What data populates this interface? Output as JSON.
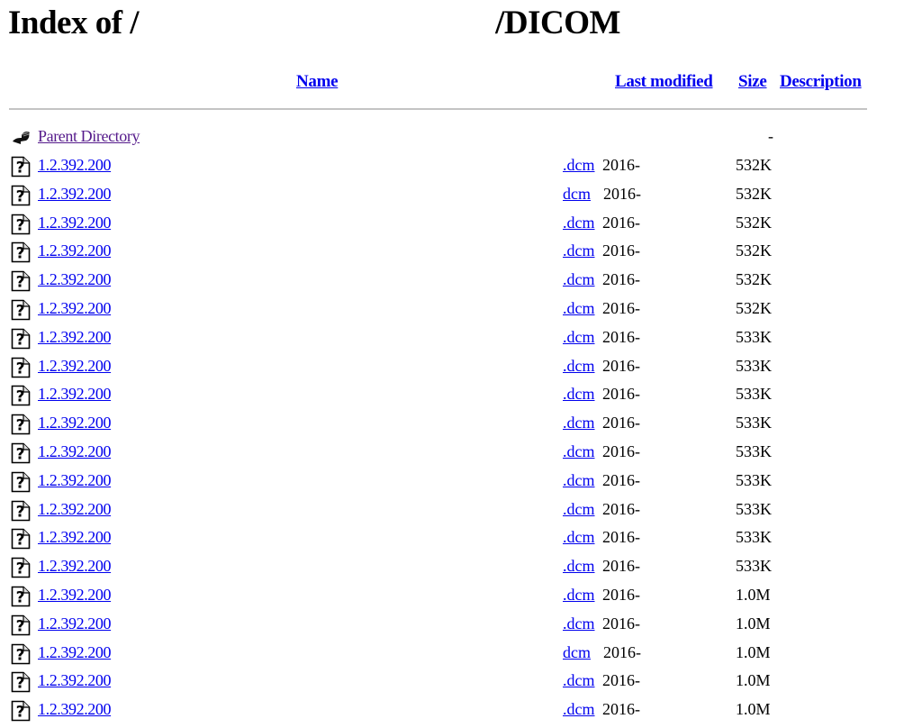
{
  "title": {
    "prefix": "Index of /",
    "suffix": "/DICOM"
  },
  "columns": {
    "name": "Name",
    "last_modified": "Last modified",
    "size": "Size",
    "description": "Description"
  },
  "parent": {
    "label": "Parent Directory",
    "size": "-",
    "icon": "back-arrow-icon"
  },
  "files": [
    {
      "name": "1.2.392.200",
      "ext": ".dcm",
      "date": "2016-",
      "size": "532K",
      "icon": "unknown-file-icon"
    },
    {
      "name": "1.2.392.200",
      "ext": "dcm",
      "date": "2016-",
      "size": "532K",
      "icon": "unknown-file-icon"
    },
    {
      "name": "1.2.392.200",
      "ext": ".dcm",
      "date": "2016-",
      "size": "532K",
      "icon": "unknown-file-icon"
    },
    {
      "name": "1.2.392.200",
      "ext": ".dcm",
      "date": "2016-",
      "size": "532K",
      "icon": "unknown-file-icon"
    },
    {
      "name": "1.2.392.200",
      "ext": ".dcm",
      "date": "2016-",
      "size": "532K",
      "icon": "unknown-file-icon"
    },
    {
      "name": "1.2.392.200",
      "ext": ".dcm",
      "date": "2016-",
      "size": "532K",
      "icon": "unknown-file-icon"
    },
    {
      "name": "1.2.392.200",
      "ext": ".dcm",
      "date": "2016-",
      "size": "533K",
      "icon": "unknown-file-icon"
    },
    {
      "name": "1.2.392.200",
      "ext": ".dcm",
      "date": "2016-",
      "size": "533K",
      "icon": "unknown-file-icon"
    },
    {
      "name": "1.2.392.200",
      "ext": ".dcm",
      "date": "2016-",
      "size": "533K",
      "icon": "unknown-file-icon"
    },
    {
      "name": "1.2.392.200",
      "ext": ".dcm",
      "date": "2016-",
      "size": "533K",
      "icon": "unknown-file-icon"
    },
    {
      "name": "1.2.392.200",
      "ext": ".dcm",
      "date": "2016-",
      "size": "533K",
      "icon": "unknown-file-icon"
    },
    {
      "name": "1.2.392.200",
      "ext": ".dcm",
      "date": "2016-",
      "size": "533K",
      "icon": "unknown-file-icon"
    },
    {
      "name": "1.2.392.200",
      "ext": ".dcm",
      "date": "2016-",
      "size": "533K",
      "icon": "unknown-file-icon"
    },
    {
      "name": "1.2.392.200",
      "ext": ".dcm",
      "date": "2016-",
      "size": "533K",
      "icon": "unknown-file-icon"
    },
    {
      "name": "1.2.392.200",
      "ext": ".dcm",
      "date": "2016-",
      "size": "533K",
      "icon": "unknown-file-icon"
    },
    {
      "name": "1.2.392.200",
      "ext": ".dcm",
      "date": "2016-",
      "size": "1.0M",
      "icon": "unknown-file-icon"
    },
    {
      "name": "1.2.392.200",
      "ext": ".dcm",
      "date": "2016-",
      "size": "1.0M",
      "icon": "unknown-file-icon"
    },
    {
      "name": "1.2.392.200",
      "ext": "dcm",
      "date": "2016-",
      "size": "1.0M",
      "icon": "unknown-file-icon"
    },
    {
      "name": "1.2.392.200",
      "ext": ".dcm",
      "date": "2016-",
      "size": "1.0M",
      "icon": "unknown-file-icon"
    },
    {
      "name": "1.2.392.200",
      "ext": ".dcm",
      "date": "2016-",
      "size": "1.0M",
      "icon": "unknown-file-icon"
    }
  ]
}
